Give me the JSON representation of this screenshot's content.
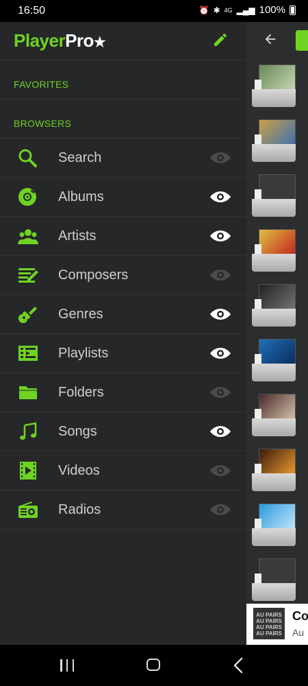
{
  "status_bar": {
    "time": "16:50",
    "network": "4G",
    "battery": "100%",
    "icons": [
      "alarm-icon",
      "bluetooth-icon",
      "signal-icon",
      "battery-icon"
    ]
  },
  "drawer": {
    "logo_main": "Player",
    "logo_pro": "Pro",
    "favorites_title": "FAVORITES",
    "browsers_title": "BROWSERS",
    "items": [
      {
        "label": "Search",
        "icon": "search-icon",
        "visible": false
      },
      {
        "label": "Albums",
        "icon": "album-disc-icon",
        "visible": true
      },
      {
        "label": "Artists",
        "icon": "artists-icon",
        "visible": true
      },
      {
        "label": "Composers",
        "icon": "composers-icon",
        "visible": false
      },
      {
        "label": "Genres",
        "icon": "guitar-icon",
        "visible": true
      },
      {
        "label": "Playlists",
        "icon": "playlist-icon",
        "visible": true
      },
      {
        "label": "Folders",
        "icon": "folder-icon",
        "visible": false
      },
      {
        "label": "Songs",
        "icon": "music-note-icon",
        "visible": true
      },
      {
        "label": "Videos",
        "icon": "video-icon",
        "visible": false
      },
      {
        "label": "Radios",
        "icon": "radio-icon",
        "visible": false
      }
    ]
  },
  "now_playing": {
    "title_partial": "Co",
    "artist_partial": "Au",
    "thumb_text": "AU PAIRS AU PAIRS AU PAIRS AU PAIRS"
  },
  "colors": {
    "accent": "#6fd321",
    "drawer_bg": "#262729",
    "text": "#cfcfcf",
    "eye_visible": "#ffffff",
    "eye_hidden": "#4a4b4d"
  }
}
